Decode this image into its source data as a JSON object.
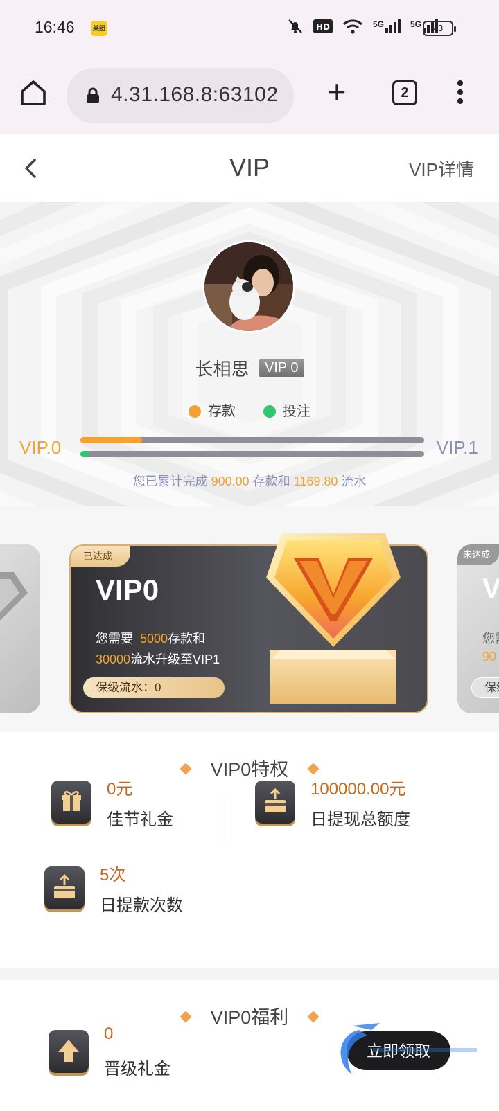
{
  "status_bar": {
    "time": "16:46",
    "app_badge": "美团",
    "network_1": "5G",
    "network_2": "5G",
    "battery": "43"
  },
  "browser": {
    "url": "4.31.168.8:63102",
    "tab_count": "2",
    "plus": "+"
  },
  "header": {
    "title": "VIP",
    "detail_link": "VIP详情"
  },
  "profile": {
    "username": "长相思",
    "vip_badge": "VIP 0"
  },
  "legend": {
    "deposit": "存款",
    "bet": "投注",
    "deposit_color": "#f4a236",
    "bet_color": "#2ec76b"
  },
  "progress": {
    "from_level": "VIP.0",
    "to_level": "VIP.1",
    "deposit_fraction": 0.18,
    "bet_fraction": 0.025,
    "summary_prefix": "您已累计完成",
    "deposit_amount": "900.00",
    "summary_mid": "存款和",
    "turnover_amount": "1169.80",
    "summary_suffix": "流水"
  },
  "cards": {
    "current": {
      "status": "已达成",
      "level": "VIP0",
      "line1_prefix": "您需要",
      "line1_amount": "5000",
      "line1_suffix": "存款和",
      "line2_amount": "30000",
      "line2_suffix": "流水升级至VIP1",
      "retain_label": "保级流水：",
      "retain_value": "0"
    },
    "next": {
      "status": "未达成",
      "level": "V",
      "desc": "您需",
      "num": "90",
      "retain": "保级"
    }
  },
  "privileges": {
    "title": "VIP0特权",
    "items": [
      {
        "value": "0元",
        "label": "佳节礼金",
        "icon": "gift-icon"
      },
      {
        "value": "100000.00元",
        "label": "日提现总额度",
        "icon": "wallet-icon"
      },
      {
        "value": "5次",
        "label": "日提款次数",
        "icon": "wallet-icon"
      }
    ]
  },
  "benefits": {
    "title": "VIP0福利",
    "items": [
      {
        "value": "0",
        "label": "晋级礼金",
        "icon": "arrow-up-icon"
      }
    ],
    "claim_button": "立即领取"
  },
  "colors": {
    "accent_gold": "#f2a52a",
    "accent_orange": "#c8691c",
    "muted_blue": "#8a90b6"
  }
}
